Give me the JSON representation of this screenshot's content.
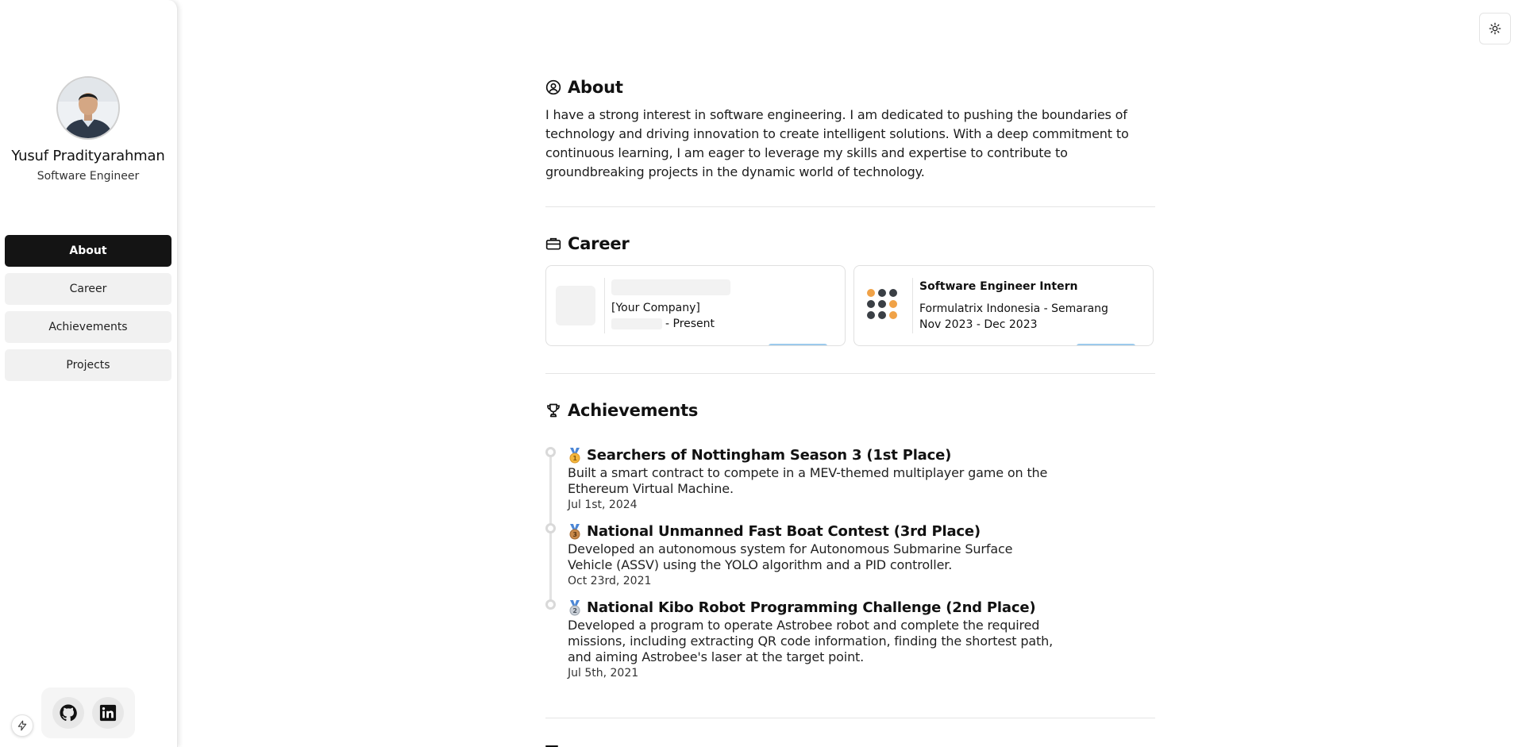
{
  "profile": {
    "name": "Yusuf Pradityarahman",
    "role": "Software Engineer"
  },
  "nav": {
    "items": [
      {
        "label": "About",
        "active": true
      },
      {
        "label": "Career",
        "active": false
      },
      {
        "label": "Achievements",
        "active": false
      },
      {
        "label": "Projects",
        "active": false
      }
    ]
  },
  "social": {
    "icons": [
      "github-icon",
      "linkedin-icon"
    ]
  },
  "about": {
    "title": "About",
    "text": "I have a strong interest in software engineering. I am dedicated to pushing the boundaries of technology and driving innovation to create intelligent solutions. With a deep commitment to continuous learning, I am eager to leverage my skills and expertise to contribute to groundbreaking projects in the dynamic world of technology."
  },
  "career": {
    "title": "Career",
    "cards": [
      {
        "title": "",
        "company": "[Your Company]",
        "period": "- Present",
        "loading": true
      },
      {
        "title": "Software Engineer Intern",
        "company": "Formulatrix Indonesia - Semarang",
        "period": "Nov 2023 - Dec 2023",
        "loading": false
      }
    ]
  },
  "achievements": {
    "title": "Achievements",
    "items": [
      {
        "medal": "gold",
        "title": "Searchers of Nottingham Season 3 (1st Place)",
        "description": "Built a smart contract to compete in a MEV-themed multiplayer game on the Ethereum Virtual Machine.",
        "date": "Jul 1st, 2024"
      },
      {
        "medal": "bronze",
        "title": "National Unmanned Fast Boat Contest (3rd Place)",
        "description": "Developed an autonomous system for Autonomous Submarine Surface Vehicle (ASSV) using the YOLO algorithm and a PID controller.",
        "date": "Oct 23rd, 2021"
      },
      {
        "medal": "silver",
        "title": "National Kibo Robot Programming Challenge (2nd Place)",
        "description": "Developed a program to operate Astrobee robot and complete the required missions, including extracting QR code information, finding the shortest path, and aiming Astrobee's laser at the target point.",
        "date": "Jul 5th, 2021"
      }
    ]
  },
  "colors": {
    "nav_active_bg": "#141414",
    "nav_bg": "#f1f1f1",
    "card_accent": "#9ccaec",
    "medal_gold": "#f4b73b",
    "medal_silver": "#c8ced6",
    "medal_bronze": "#c98a4b",
    "formulatrix_orange": "#f0a247",
    "formulatrix_dark": "#3a3f45"
  }
}
